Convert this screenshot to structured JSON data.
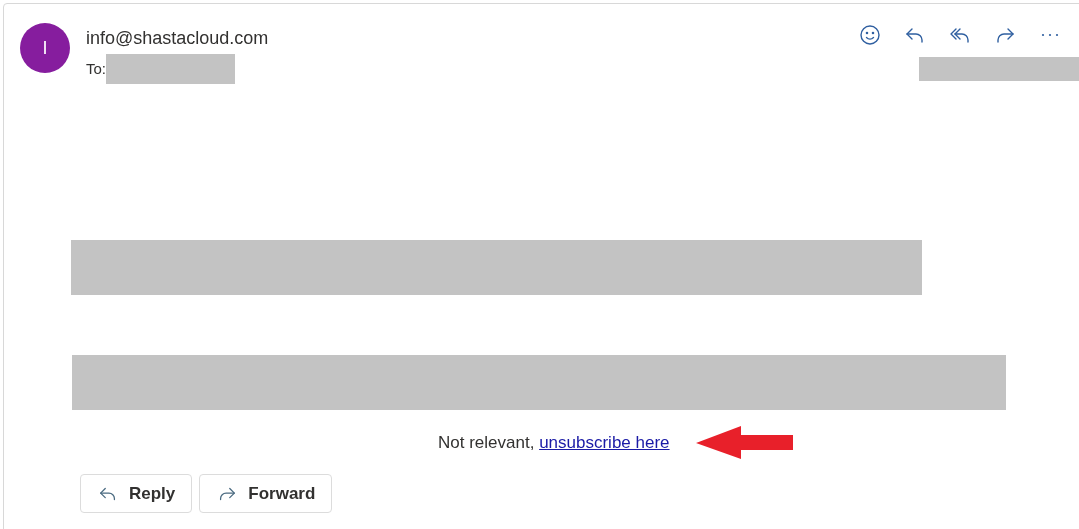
{
  "message": {
    "avatar_initial": "I",
    "sender": "info@shastacloud.com",
    "to_label": "To:"
  },
  "toolbar": [
    {
      "kind": "emoji"
    },
    {
      "kind": "reply"
    },
    {
      "kind": "reply_all"
    },
    {
      "kind": "forward"
    },
    {
      "kind": "more"
    }
  ],
  "body": {
    "text": "Not relevant,",
    "link": "unsubscribe here"
  },
  "actions": [
    {
      "kind": "reply",
      "label": "Reply"
    },
    {
      "kind": "forward",
      "label": "Forward"
    }
  ]
}
